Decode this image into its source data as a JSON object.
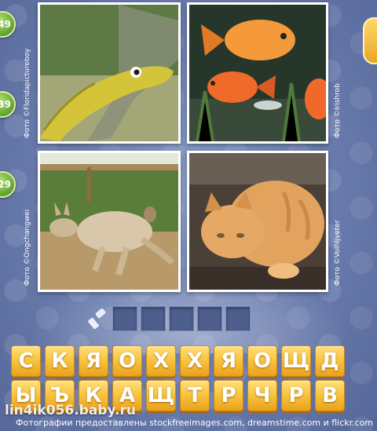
{
  "badges": [
    "49",
    "39",
    "29"
  ],
  "photos": [
    {
      "subject": "snake",
      "credit": "Фото ©Floridapictureboy"
    },
    {
      "subject": "fish",
      "credit": "Фото ©Irishrob"
    },
    {
      "subject": "kangaroo",
      "credit": "Фото ©Ongchangwei"
    },
    {
      "subject": "cat",
      "credit": "Фото ©Volhljveter"
    }
  ],
  "answer_slots": 5,
  "letters_row1": [
    "С",
    "К",
    "Я",
    "О",
    "Х",
    "Х",
    "Я",
    "О",
    "Щ",
    "Д"
  ],
  "letters_row2": [
    "Ы",
    "Ъ",
    "К",
    "А",
    "Щ",
    "Т",
    "Р",
    "Ч",
    "Р",
    "В"
  ],
  "footer_text": "Фотографии предоставлены stockfreeimages.com, dreamstime.com и flickr.com",
  "watermark": "lin4ik056.baby.ru"
}
